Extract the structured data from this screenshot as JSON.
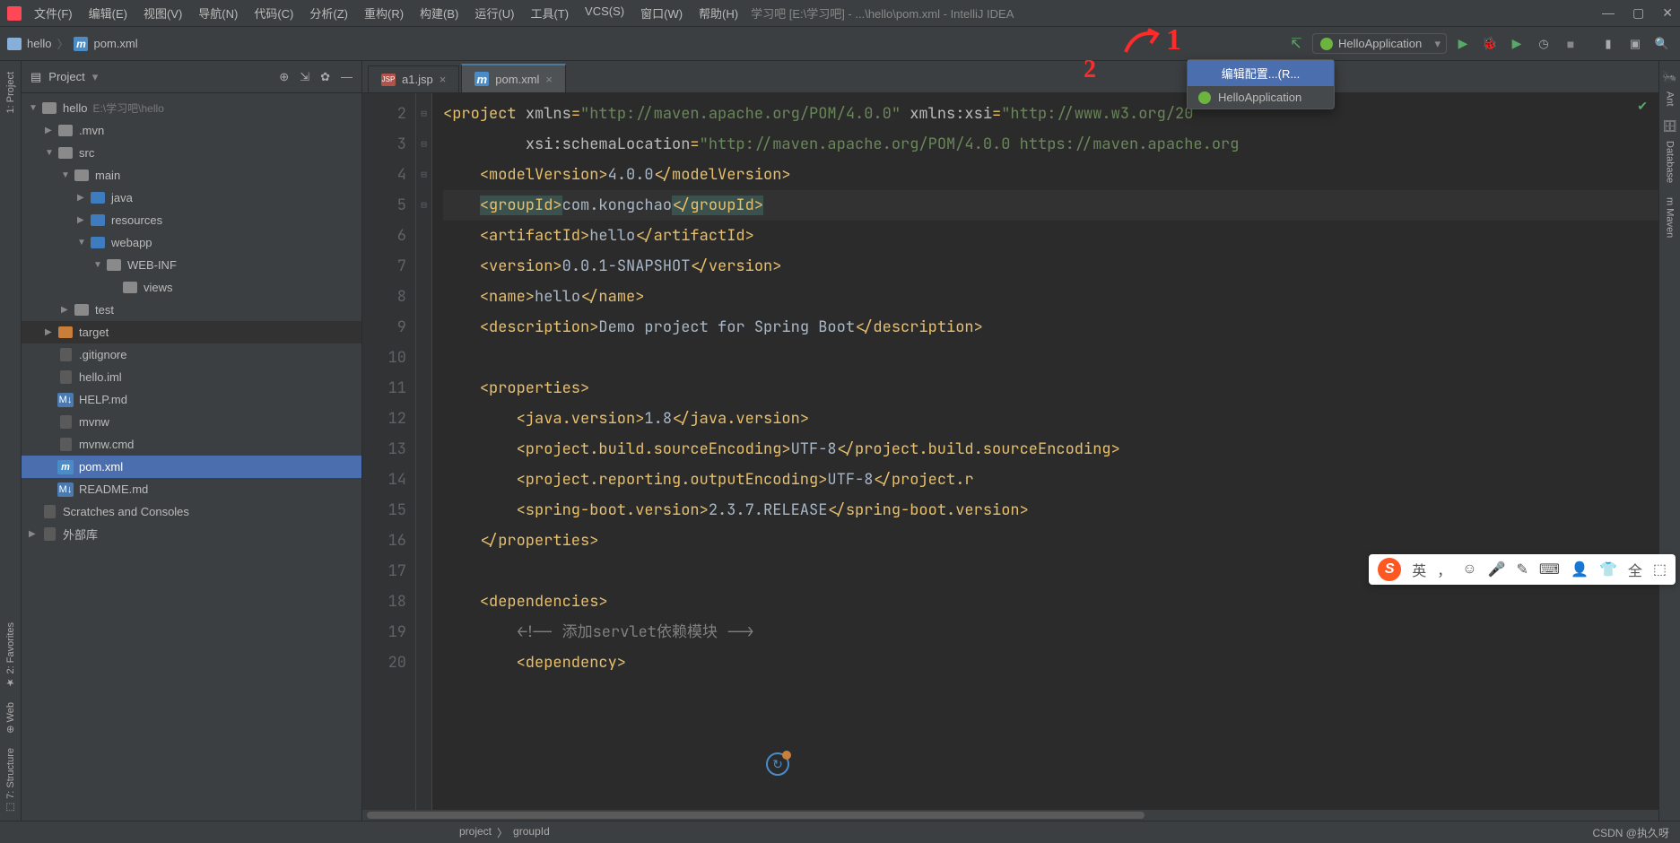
{
  "title": "学习吧 [E:\\学习吧] - ...\\hello\\pom.xml - IntelliJ IDEA",
  "menus": [
    "文件(F)",
    "编辑(E)",
    "视图(V)",
    "导航(N)",
    "代码(C)",
    "分析(Z)",
    "重构(R)",
    "构建(B)",
    "运行(U)",
    "工具(T)",
    "VCS(S)",
    "窗口(W)",
    "帮助(H)"
  ],
  "breadcrumb": {
    "project": "hello",
    "file": "pom.xml"
  },
  "runConfig": {
    "name": "HelloApplication"
  },
  "runMenu": {
    "edit": "编辑配置...(R...",
    "app": "HelloApplication"
  },
  "annotations": {
    "one": "1",
    "two": "2"
  },
  "projectHeader": "Project",
  "tree": [
    {
      "d": 0,
      "a": "▼",
      "icon": "folder-open",
      "name": "hello",
      "suffix": "E:\\学习吧\\hello"
    },
    {
      "d": 1,
      "a": "▶",
      "icon": "folder",
      "name": ".mvn"
    },
    {
      "d": 1,
      "a": "▼",
      "icon": "folder-open",
      "name": "src"
    },
    {
      "d": 2,
      "a": "▼",
      "icon": "folder-open",
      "name": "main"
    },
    {
      "d": 3,
      "a": "▶",
      "icon": "folder-blue",
      "name": "java"
    },
    {
      "d": 3,
      "a": "▶",
      "icon": "folder-blue",
      "name": "resources"
    },
    {
      "d": 3,
      "a": "▼",
      "icon": "folder-blue",
      "name": "webapp"
    },
    {
      "d": 4,
      "a": "▼",
      "icon": "folder",
      "name": "WEB-INF"
    },
    {
      "d": 5,
      "a": "",
      "icon": "folder",
      "name": "views"
    },
    {
      "d": 2,
      "a": "▶",
      "icon": "folder",
      "name": "test"
    },
    {
      "d": 1,
      "a": "▶",
      "icon": "folder-orange",
      "name": "target",
      "cls": "target-hl"
    },
    {
      "d": 1,
      "a": "",
      "icon": "file",
      "name": ".gitignore"
    },
    {
      "d": 1,
      "a": "",
      "icon": "file",
      "name": "hello.iml"
    },
    {
      "d": 1,
      "a": "",
      "icon": "md",
      "name": "HELP.md"
    },
    {
      "d": 1,
      "a": "",
      "icon": "file",
      "name": "mvnw"
    },
    {
      "d": 1,
      "a": "",
      "icon": "file",
      "name": "mvnw.cmd"
    },
    {
      "d": 1,
      "a": "",
      "icon": "m",
      "name": "pom.xml",
      "cls": "selected-hl"
    },
    {
      "d": 1,
      "a": "",
      "icon": "md",
      "name": "README.md"
    },
    {
      "d": 0,
      "a": "",
      "icon": "file",
      "name": "Scratches and Consoles"
    },
    {
      "d": 0,
      "a": "▶",
      "icon": "file",
      "name": "外部库"
    }
  ],
  "tabs": [
    {
      "icon": "jsp",
      "name": "a1.jsp",
      "active": false
    },
    {
      "icon": "m",
      "name": "pom.xml",
      "active": true
    }
  ],
  "leftTools": [
    "1: Project"
  ],
  "leftToolsBottom": [
    "★ 2: Favorites",
    "⊕ Web",
    "⬚ 7: Structure"
  ],
  "rightTools": [
    "Ant",
    "Database",
    "m Maven"
  ],
  "code": {
    "start": 2,
    "lines": [
      {
        "n": 2,
        "h": "<span class='tag'>&lt;project</span> <span class='attr'>xmlns</span><span class='tag'>=</span><span class='str'>\"http://maven.apache.org/POM/4.0.0\"</span> <span class='attr'>xmlns:xsi</span><span class='tag'>=</span><span class='str'>\"http://www.w3.org/20</span>"
      },
      {
        "n": 3,
        "h": "         <span class='attr'>xsi:schemaLocation</span><span class='tag'>=</span><span class='str'>\"http://maven.apache.org/POM/4.0.0 https://maven.apache.org</span>"
      },
      {
        "n": 4,
        "h": "    <span class='tag'>&lt;modelVersion&gt;</span><span class='txt'>4.0.0</span><span class='tag'>&lt;/modelVersion&gt;</span>"
      },
      {
        "n": 5,
        "h": "    <span class='hl-span'><span class='tag'>&lt;groupId&gt;</span></span><span class='txt'>com.kongchao</span><span class='hl-span'><span class='tag'>&lt;/groupId&gt;</span></span>",
        "cursor": true
      },
      {
        "n": 6,
        "h": "    <span class='tag'>&lt;artifactId&gt;</span><span class='txt'>hello</span><span class='tag'>&lt;/artifactId&gt;</span>"
      },
      {
        "n": 7,
        "h": "    <span class='tag'>&lt;version&gt;</span><span class='txt'>0.0.1-SNAPSHOT</span><span class='tag'>&lt;/version&gt;</span>"
      },
      {
        "n": 8,
        "h": "    <span class='tag'>&lt;name&gt;</span><span class='txt'>hello</span><span class='tag'>&lt;/name&gt;</span>"
      },
      {
        "n": 9,
        "h": "    <span class='tag'>&lt;description&gt;</span><span class='txt'>Demo project for Spring Boot</span><span class='tag'>&lt;/description&gt;</span>"
      },
      {
        "n": 10,
        "h": ""
      },
      {
        "n": 11,
        "h": "    <span class='tag'>&lt;properties&gt;</span>"
      },
      {
        "n": 12,
        "h": "        <span class='tag'>&lt;java.version&gt;</span><span class='txt'>1.8</span><span class='tag'>&lt;/java.version&gt;</span>"
      },
      {
        "n": 13,
        "h": "        <span class='tag'>&lt;project.build.sourceEncoding&gt;</span><span class='txt'>UTF-8</span><span class='tag'>&lt;/project.build.sourceEncoding&gt;</span>"
      },
      {
        "n": 14,
        "h": "        <span class='tag'>&lt;project.reporting.outputEncoding&gt;</span><span class='txt'>UTF-8</span><span class='tag'>&lt;/project.r</span>"
      },
      {
        "n": 15,
        "h": "        <span class='tag'>&lt;spring-boot.version&gt;</span><span class='txt'>2.3.7.RELEASE</span><span class='tag'>&lt;/spring-boot.version&gt;</span>"
      },
      {
        "n": 16,
        "h": "    <span class='tag'>&lt;/properties&gt;</span>"
      },
      {
        "n": 17,
        "h": ""
      },
      {
        "n": 18,
        "h": "    <span class='tag'>&lt;dependencies&gt;</span>"
      },
      {
        "n": 19,
        "h": "        <span class='comment'>&lt;!-- 添加servlet依赖模块 --&gt;</span>"
      },
      {
        "n": 20,
        "h": "        <span class='tag'>&lt;dependency&gt;</span>"
      }
    ]
  },
  "status": {
    "crumbs": [
      "project",
      "groupId"
    ],
    "watermark": "CSDN @执久呀"
  },
  "ime": [
    "英",
    "，",
    "☺",
    "🎤",
    "✎",
    "⌨",
    "👤",
    "👕",
    "全",
    "⬚"
  ]
}
